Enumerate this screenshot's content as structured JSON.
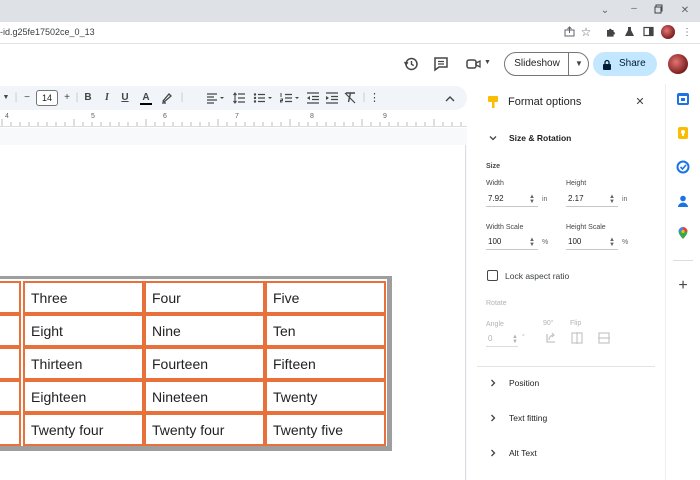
{
  "browser": {
    "url": "-id.g25fe17502ce_0_13"
  },
  "header": {
    "slideshow_label": "Slideshow",
    "share_label": "Share"
  },
  "toolbar": {
    "font_size": "14",
    "minus": "−",
    "plus": "+",
    "bold": "B",
    "italic": "I",
    "underline": "U",
    "text_color": "A"
  },
  "ruler": {
    "marks": [
      "4",
      "5",
      "6",
      "7",
      "8",
      "9"
    ]
  },
  "table": {
    "rows": [
      [
        "Three",
        "Four",
        "Five"
      ],
      [
        "Eight",
        "Nine",
        "Ten"
      ],
      [
        "Thirteen",
        "Fourteen",
        "Fifteen"
      ],
      [
        "Eighteen",
        "Nineteen",
        "Twenty"
      ],
      [
        "Twenty four",
        "Twenty four",
        "Twenty five"
      ]
    ]
  },
  "format_panel": {
    "title": "Format options",
    "size_rotation": "Size & Rotation",
    "size": "Size",
    "width_label": "Width",
    "width_value": "7.92",
    "width_unit": "in",
    "height_label": "Height",
    "height_value": "2.17",
    "height_unit": "in",
    "width_scale_label": "Width Scale",
    "width_scale_value": "100",
    "width_scale_unit": "%",
    "height_scale_label": "Height Scale",
    "height_scale_value": "100",
    "height_scale_unit": "%",
    "lock_aspect": "Lock aspect ratio",
    "rotate": "Rotate",
    "angle": "Angle",
    "angle_value": "0",
    "angle_unit": "°",
    "ninety": "90°",
    "flip": "Flip",
    "position": "Position",
    "text_fitting": "Text fitting",
    "alt_text": "Alt Text"
  },
  "colors": {
    "table_border": "#e8703a",
    "share_bg": "#c2e7ff",
    "panel_icon": "#fbbc04"
  }
}
